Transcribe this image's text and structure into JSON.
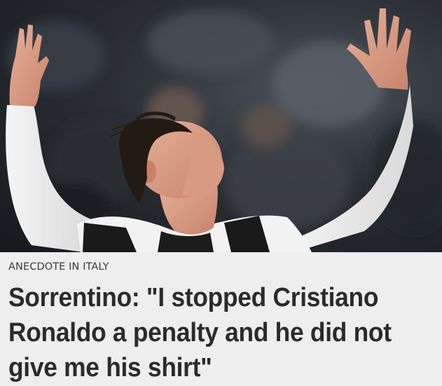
{
  "article": {
    "image_subject": "football player with raised arms",
    "category": "ANECDOTE IN ITALY",
    "headline": "Sorrentino: \"I stopped Cristiano Ronaldo a penalty and he did not give me his shirt\""
  },
  "colors": {
    "background": "#eeeeee",
    "headline": "#2b2b2b",
    "category": "#3a3a3a",
    "photo_dark": "#16181c"
  }
}
